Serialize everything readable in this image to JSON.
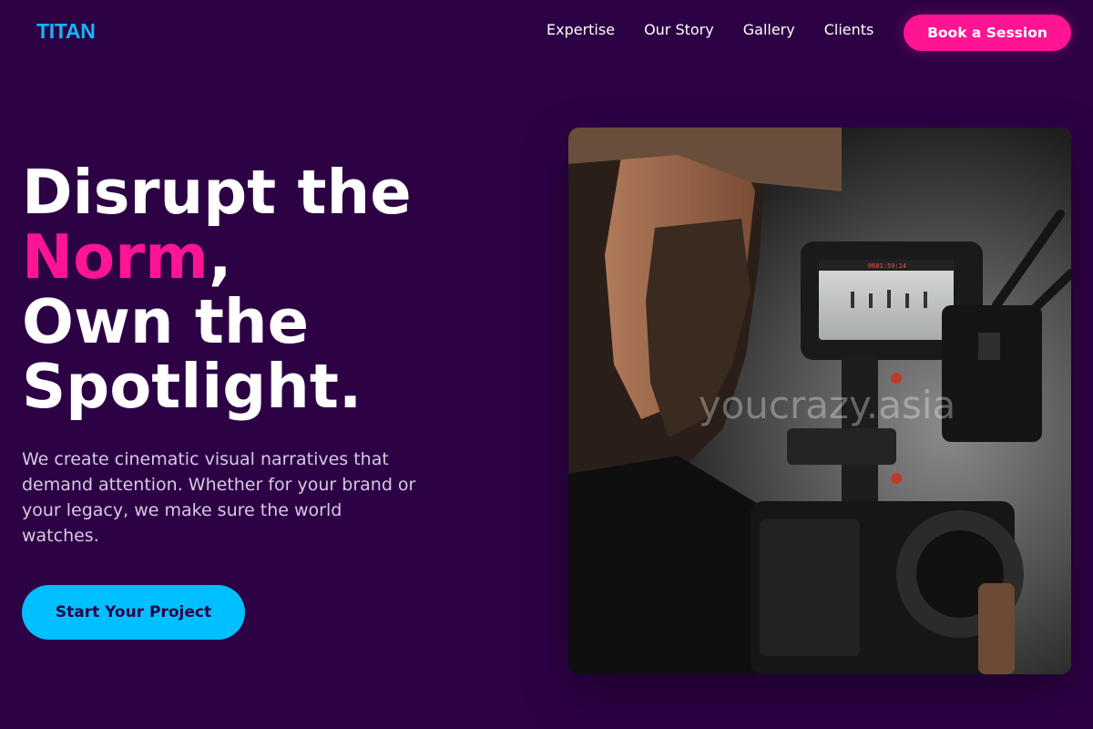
{
  "header": {
    "logo": "TITAN",
    "nav": [
      "Expertise",
      "Our Story",
      "Gallery",
      "Clients"
    ],
    "cta": "Book a Session"
  },
  "hero": {
    "headline": {
      "line1": "Disrupt the",
      "accent": "Norm",
      "comma": ",",
      "line3": "Own the",
      "line4": "Spotlight."
    },
    "description": "We create cinematic visual narratives that demand attention. Whether for your brand or your legacy, we make sure the world watches.",
    "cta": "Start Your Project",
    "image": {
      "icon": "videographer-photo",
      "watermark": "youcrazy.asia",
      "monitor_readout": "0601:59:14"
    }
  },
  "colors": {
    "background": "#2d0245",
    "accent_pink": "#ff1493",
    "accent_cyan": "#00bfff",
    "logo": "#18b4f5"
  }
}
